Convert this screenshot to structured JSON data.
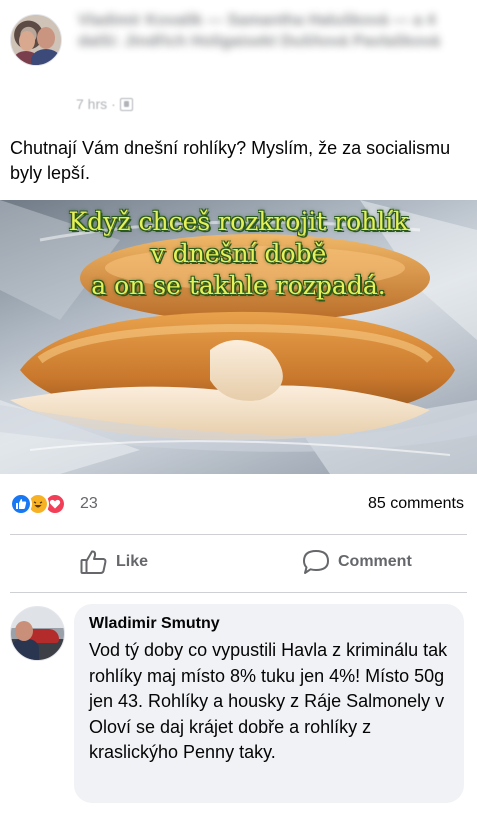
{
  "post": {
    "author_blurred": "Vladimír Kovalík — Samantha Halušková — a 4 další: Jindřich Holigaisekt Dušňová Pavlašková",
    "time": "7 hrs",
    "visibility_icon": "friends-icon",
    "text": "Chutnají Vám dnešní rohlíky? Myslím, že za socialismu byly lepší.",
    "image_caption": [
      "Když chceš rozkrojit rohlík",
      "v dnešní době",
      "a on se takhle rozpadá."
    ]
  },
  "reactions": {
    "icons": [
      "like-icon",
      "haha-icon",
      "love-icon"
    ],
    "count": "23",
    "comments": "85 comments"
  },
  "actions": {
    "like_label": "Like",
    "comment_label": "Comment"
  },
  "comment": {
    "author": "Wladimir Smutny",
    "text": "Vod tý doby co vypustili Havla z kriminálu tak rohlíky maj místo 8% tuku jen 4%! Místo 50g jen 43. Rohlíky a housky z Ráje Salmonely v Oloví se daj krájet dobře a rohlíky z kraslickýho Penny taky."
  },
  "colors": {
    "like_blue": "#1877f2",
    "haha_yellow": "#f7b125",
    "love_red": "#f33e58",
    "secondary_text": "#65676b",
    "bubble_bg": "#f0f2f5",
    "caption_yellow": "#e6f05a"
  }
}
